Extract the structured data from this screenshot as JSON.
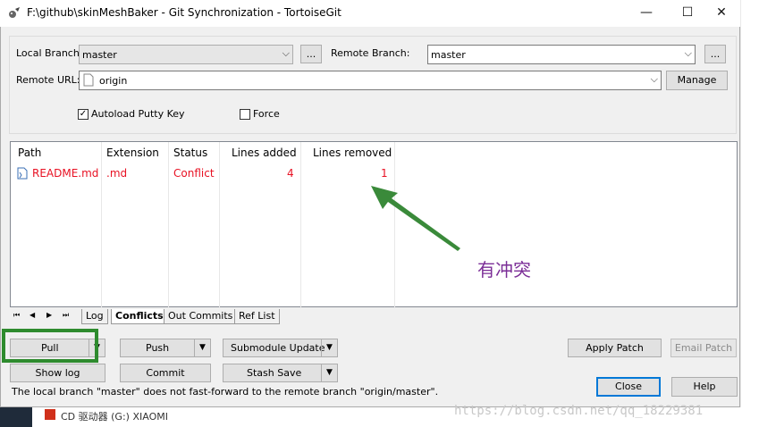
{
  "window": {
    "title": "F:\\github\\skinMeshBaker - Git Synchronization - TortoiseGit",
    "minimize": "—",
    "maximize": "☐",
    "close": "✕"
  },
  "branches": {
    "local_label": "Local Branch:",
    "local_value": "master",
    "local_browse": "...",
    "remote_label": "Remote Branch:",
    "remote_value": "master",
    "remote_browse": "...",
    "url_label": "Remote URL:",
    "url_value": "origin",
    "manage_label": "Manage"
  },
  "options": {
    "autoload_label": "Autoload Putty Key",
    "autoload_checked": "✓",
    "force_label": "Force"
  },
  "table": {
    "columns": [
      "Path",
      "Extension",
      "Status",
      "Lines added",
      "Lines removed"
    ],
    "rows": [
      {
        "path": "README.md",
        "extension": ".md",
        "status": "Conflict",
        "lines_added": "4",
        "lines_removed": "1"
      }
    ]
  },
  "tabs": {
    "nav": [
      "⏮",
      "◀",
      "▶",
      "⏭"
    ],
    "items": [
      "Log",
      "Conflicts",
      "Out Commits",
      "Ref List"
    ],
    "active": "Conflicts"
  },
  "buttons": {
    "pull": "Pull",
    "push": "Push",
    "submodule_update": "Submodule Update",
    "apply_patch": "Apply Patch",
    "email_patch": "Email Patch",
    "show_log": "Show log",
    "commit": "Commit",
    "stash_save": "Stash Save",
    "close": "Close",
    "help": "Help",
    "dropdown_arrow": "▼"
  },
  "status_message": "The local branch \"master\" does not fast-forward to the remote branch \"origin/master\".",
  "annotation": {
    "text": "有冲突",
    "arrow_color": "#3a8a3a",
    "text_color": "#7b2e97",
    "highlight_color": "#2e8b2e"
  },
  "taskbar": {
    "item_text": "CD 驱动器 (G:) XIAOMI"
  },
  "watermark": "https://blog.csdn.net/qq_18229381",
  "colors": {
    "conflict_text": "#e81123",
    "window_bg": "#f0f0f0"
  }
}
